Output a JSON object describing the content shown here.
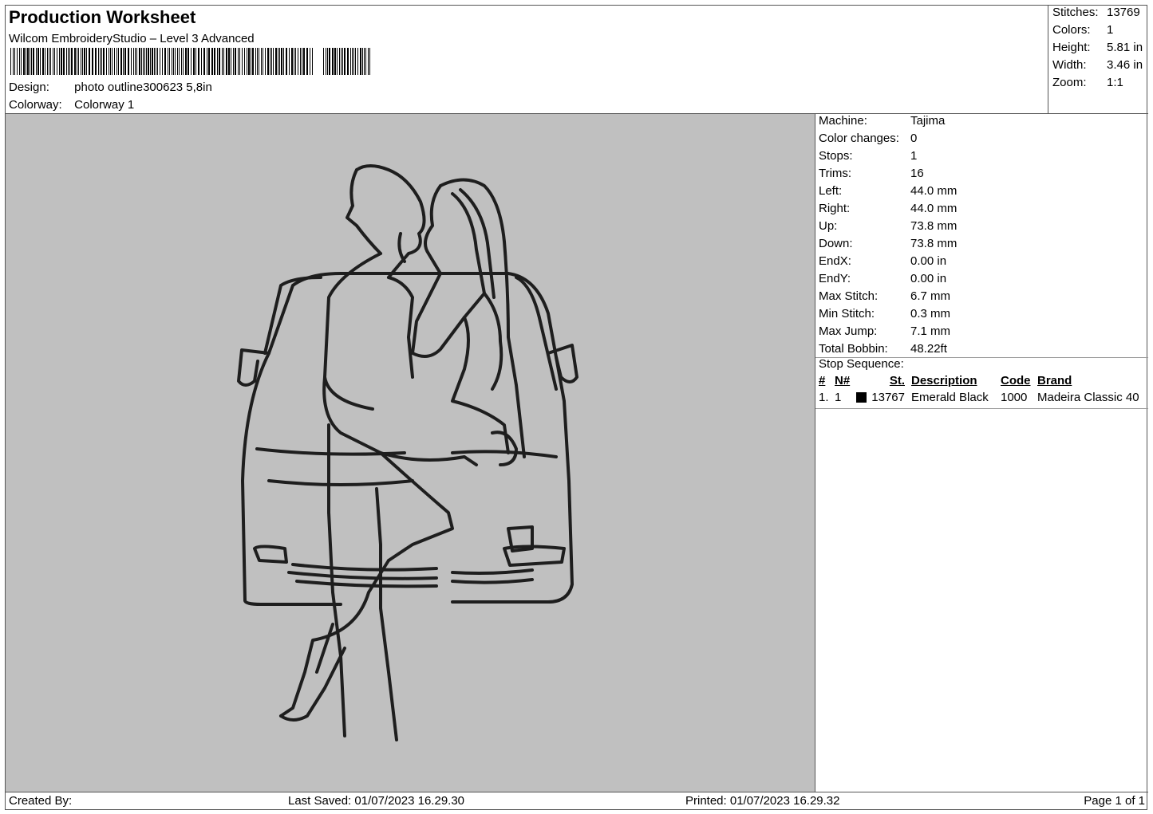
{
  "header": {
    "title": "Production Worksheet",
    "subtitle": "Wilcom EmbroideryStudio – Level 3 Advanced",
    "design_label": "Design:",
    "design_value": "photo outline300623 5,8in",
    "colorway_label": "Colorway:",
    "colorway_value": "Colorway 1"
  },
  "stats": [
    {
      "label": "Stitches:",
      "value": "13769"
    },
    {
      "label": "Colors:",
      "value": "1"
    },
    {
      "label": "Height:",
      "value": "5.81 in"
    },
    {
      "label": "Width:",
      "value": "3.46 in"
    },
    {
      "label": "Zoom:",
      "value": "1:1"
    }
  ],
  "machine_info": [
    {
      "label": "Machine:",
      "value": "Tajima"
    },
    {
      "label": "Color changes:",
      "value": "0"
    },
    {
      "label": "Stops:",
      "value": "1"
    },
    {
      "label": "Trims:",
      "value": "16"
    },
    {
      "label": "Left:",
      "value": "44.0 mm"
    },
    {
      "label": "Right:",
      "value": "44.0 mm"
    },
    {
      "label": "Up:",
      "value": "73.8 mm"
    },
    {
      "label": "Down:",
      "value": "73.8 mm"
    },
    {
      "label": "EndX:",
      "value": "0.00 in"
    },
    {
      "label": "EndY:",
      "value": "0.00 in"
    },
    {
      "label": "Max Stitch:",
      "value": "6.7 mm"
    },
    {
      "label": "Min Stitch:",
      "value": "0.3 mm"
    },
    {
      "label": "Max Jump:",
      "value": "7.1 mm"
    },
    {
      "label": "Total Bobbin:",
      "value": "48.22ft"
    }
  ],
  "stop_sequence": {
    "title": "Stop Sequence:",
    "columns": {
      "num": "#",
      "n": "N#",
      "st": "St.",
      "desc": "Description",
      "code": "Code",
      "brand": "Brand"
    },
    "rows": [
      {
        "num": "1.",
        "n": "1",
        "swatch": "#000000",
        "st": "13767",
        "desc": "Emerald Black",
        "code": "1000",
        "brand": "Madeira Classic 40"
      }
    ]
  },
  "footer": {
    "created": "Created By:",
    "saved": "Last Saved: 01/07/2023 16.29.30",
    "printed": "Printed: 01/07/2023 16.29.32",
    "page": "Page 1 of 1"
  },
  "colors": {
    "canvas_bg": "#c0c0c0",
    "thread": "#1e1e1e"
  }
}
